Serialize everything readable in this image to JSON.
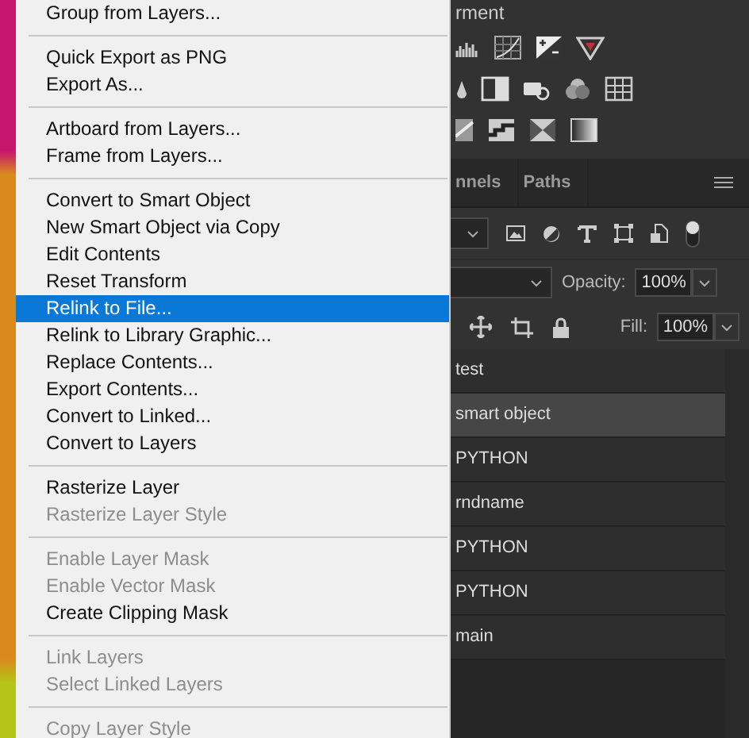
{
  "menu": {
    "sections": [
      {
        "items": [
          {
            "label": "Group from Layers...",
            "disabled": false,
            "selected": false
          }
        ]
      },
      {
        "items": [
          {
            "label": "Quick Export as PNG",
            "disabled": false,
            "selected": false
          },
          {
            "label": "Export As...",
            "disabled": false,
            "selected": false
          }
        ]
      },
      {
        "items": [
          {
            "label": "Artboard from Layers...",
            "disabled": false,
            "selected": false
          },
          {
            "label": "Frame from Layers...",
            "disabled": false,
            "selected": false
          }
        ]
      },
      {
        "items": [
          {
            "label": "Convert to Smart Object",
            "disabled": false,
            "selected": false
          },
          {
            "label": "New Smart Object via Copy",
            "disabled": false,
            "selected": false
          },
          {
            "label": "Edit Contents",
            "disabled": false,
            "selected": false
          },
          {
            "label": "Reset Transform",
            "disabled": false,
            "selected": false
          },
          {
            "label": "Relink to File...",
            "disabled": false,
            "selected": true
          },
          {
            "label": "Relink to Library Graphic...",
            "disabled": false,
            "selected": false
          },
          {
            "label": "Replace Contents...",
            "disabled": false,
            "selected": false
          },
          {
            "label": "Export Contents...",
            "disabled": false,
            "selected": false
          },
          {
            "label": "Convert to Linked...",
            "disabled": false,
            "selected": false
          },
          {
            "label": "Convert to Layers",
            "disabled": false,
            "selected": false
          }
        ]
      },
      {
        "items": [
          {
            "label": "Rasterize Layer",
            "disabled": false,
            "selected": false
          },
          {
            "label": "Rasterize Layer Style",
            "disabled": true,
            "selected": false
          }
        ]
      },
      {
        "items": [
          {
            "label": "Enable Layer Mask",
            "disabled": true,
            "selected": false
          },
          {
            "label": "Enable Vector Mask",
            "disabled": true,
            "selected": false
          },
          {
            "label": "Create Clipping Mask",
            "disabled": false,
            "selected": false
          }
        ]
      },
      {
        "items": [
          {
            "label": "Link Layers",
            "disabled": true,
            "selected": false
          },
          {
            "label": "Select Linked Layers",
            "disabled": true,
            "selected": false
          }
        ]
      },
      {
        "items": [
          {
            "label": "Copy Layer Style",
            "disabled": true,
            "selected": false
          }
        ]
      }
    ]
  },
  "adjustments": {
    "title": "rment"
  },
  "tabs": [
    {
      "label": "nnels",
      "selected": false
    },
    {
      "label": "Paths",
      "selected": false
    }
  ],
  "opacity": {
    "label": "Opacity:",
    "value": "100%"
  },
  "fill": {
    "label": "Fill:",
    "value": "100%"
  },
  "layers": [
    {
      "name": "test",
      "selected": false
    },
    {
      "name": "smart object",
      "selected": true
    },
    {
      "name": "PYTHON",
      "selected": false
    },
    {
      "name": "rndname",
      "selected": false
    },
    {
      "name": "PYTHON",
      "selected": false
    },
    {
      "name": "PYTHON",
      "selected": false
    },
    {
      "name": "main",
      "selected": false
    }
  ]
}
